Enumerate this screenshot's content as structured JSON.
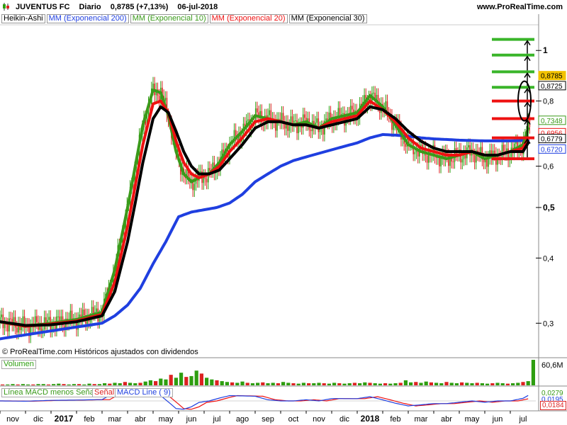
{
  "header": {
    "symbol": "JUVENTUS FC",
    "period": "Diario",
    "price": "0,8785 (+7,13%)",
    "date": "06-jul-2018",
    "brand": "www.ProRealTime.com"
  },
  "legend": {
    "heikin": "Heikin-Ashi",
    "ema200": "MM (Exponencial 200)",
    "ema10": "MM (Exponencial 10)",
    "ema20": "MM (Exponencial 20)",
    "ema30": "MM (Exponencial 30)"
  },
  "copyright": "© ProRealTime.com  Históricos ajustados con dividendos",
  "volume_panel": {
    "label": "Volumen",
    "value_label": "60,6M"
  },
  "macd_panel": {
    "label_hist": "Línea MACD menos Señal",
    "label_signal": "Señal",
    "label_line": "MACD Line ( 9)",
    "value_labels": [
      "0,0279",
      "0,0195",
      "0,0184"
    ]
  },
  "colors": {
    "ema200": "#1f3fe0",
    "ema10": "#3a9a1a",
    "ema20": "#ee1111",
    "ema30": "#000000",
    "up_candle": "#2e9e10",
    "down_candle": "#dd2222",
    "last_price": "#f2c200",
    "level_green": "#3ab52a",
    "level_red": "#ee1111"
  },
  "chart_data": {
    "type": "line",
    "scale": "log",
    "ylim": [
      0.27,
      1.12
    ],
    "x_ticks": [
      "nov",
      "dic",
      "2017",
      "feb",
      "mar",
      "abr",
      "may",
      "jun",
      "jul",
      "ago",
      "sep",
      "oct",
      "nov",
      "dic",
      "2018",
      "feb",
      "mar",
      "abr",
      "may",
      "jun",
      "jul"
    ],
    "y_ticks": [
      "1",
      "0,8",
      "0,6",
      "0,5",
      "0,4",
      "0,3"
    ],
    "y_tick_values": [
      1.0,
      0.8,
      0.6,
      0.5,
      0.4,
      0.3
    ],
    "price_labels": [
      {
        "text": "0,8785",
        "value": 0.8785,
        "color": "#f2c200"
      },
      {
        "text": "0,8725",
        "value": 0.8725,
        "color": "#000000"
      },
      {
        "text": "0,7348",
        "value": 0.7348,
        "color": "#3a9a1a"
      },
      {
        "text": "0,6956",
        "value": 0.6956,
        "color": "#ee1111"
      },
      {
        "text": "0,6779",
        "value": 0.6779,
        "color": "#000000"
      },
      {
        "text": "0,6720",
        "value": 0.672,
        "color": "#1f3fe0"
      }
    ],
    "x_months": [
      0,
      1,
      2,
      3,
      4,
      5,
      6,
      7,
      8,
      9,
      10,
      11,
      12,
      13,
      14,
      15,
      16,
      17,
      18,
      19,
      20,
      21
    ],
    "series": [
      {
        "name": "MM (Exponencial 10)",
        "color": "#3a9a1a",
        "x": [
          0,
          1,
          2,
          3,
          4,
          4.5,
          5,
          5.3,
          5.6,
          6,
          6.3,
          6.6,
          6.9,
          7.2,
          7.5,
          7.8,
          8.2,
          8.6,
          9,
          9.5,
          10,
          10.5,
          11,
          11.5,
          12,
          12.5,
          13,
          13.5,
          14,
          14.5,
          15,
          15.5,
          16,
          16.5,
          17,
          17.5,
          18,
          18.5,
          19,
          19.5,
          20,
          20.5,
          20.8
        ],
        "values": [
          0.302,
          0.296,
          0.3,
          0.305,
          0.315,
          0.38,
          0.5,
          0.6,
          0.72,
          0.84,
          0.83,
          0.75,
          0.64,
          0.58,
          0.56,
          0.57,
          0.58,
          0.61,
          0.66,
          0.7,
          0.75,
          0.74,
          0.73,
          0.72,
          0.73,
          0.71,
          0.74,
          0.75,
          0.76,
          0.82,
          0.78,
          0.72,
          0.66,
          0.64,
          0.63,
          0.62,
          0.63,
          0.64,
          0.62,
          0.63,
          0.64,
          0.66,
          0.7348
        ]
      },
      {
        "name": "MM (Exponencial 20)",
        "color": "#ee1111",
        "x": [
          0,
          1,
          2,
          3,
          4,
          4.5,
          5,
          5.3,
          5.6,
          6,
          6.3,
          6.6,
          6.9,
          7.2,
          7.5,
          7.8,
          8.2,
          8.6,
          9,
          9.5,
          10,
          10.5,
          11,
          11.5,
          12,
          12.5,
          13,
          13.5,
          14,
          14.5,
          15,
          15.5,
          16,
          16.5,
          17,
          17.5,
          18,
          18.5,
          19,
          19.5,
          20,
          20.5,
          20.8
        ],
        "values": [
          0.302,
          0.296,
          0.299,
          0.303,
          0.312,
          0.36,
          0.46,
          0.55,
          0.66,
          0.79,
          0.8,
          0.76,
          0.67,
          0.61,
          0.58,
          0.57,
          0.58,
          0.6,
          0.64,
          0.68,
          0.73,
          0.74,
          0.73,
          0.72,
          0.72,
          0.71,
          0.73,
          0.74,
          0.75,
          0.8,
          0.77,
          0.73,
          0.68,
          0.65,
          0.64,
          0.63,
          0.63,
          0.64,
          0.63,
          0.63,
          0.64,
          0.65,
          0.6956
        ]
      },
      {
        "name": "MM (Exponencial 30)",
        "color": "#000000",
        "x": [
          0,
          1,
          2,
          3,
          4,
          4.5,
          5,
          5.3,
          5.6,
          6,
          6.3,
          6.6,
          6.9,
          7.2,
          7.5,
          7.8,
          8.2,
          8.6,
          9,
          9.5,
          10,
          10.5,
          11,
          11.5,
          12,
          12.5,
          13,
          13.5,
          14,
          14.5,
          15,
          15.5,
          16,
          16.5,
          17,
          17.5,
          18,
          18.5,
          19,
          19.5,
          20,
          20.5,
          20.8
        ],
        "values": [
          0.302,
          0.297,
          0.298,
          0.302,
          0.31,
          0.345,
          0.43,
          0.51,
          0.61,
          0.74,
          0.78,
          0.76,
          0.7,
          0.64,
          0.6,
          0.58,
          0.58,
          0.59,
          0.62,
          0.66,
          0.71,
          0.73,
          0.73,
          0.72,
          0.72,
          0.71,
          0.72,
          0.73,
          0.74,
          0.78,
          0.77,
          0.74,
          0.7,
          0.67,
          0.65,
          0.64,
          0.64,
          0.64,
          0.63,
          0.63,
          0.64,
          0.64,
          0.6779
        ]
      },
      {
        "name": "MM (Exponencial 200)",
        "color": "#1f3fe0",
        "x": [
          0,
          1,
          2,
          3,
          4,
          4.5,
          5,
          5.5,
          6,
          6.5,
          7,
          7.5,
          8,
          8.5,
          9,
          9.5,
          10,
          10.5,
          11,
          11.5,
          12,
          12.5,
          13,
          13.5,
          14,
          14.5,
          15,
          15.5,
          16,
          16.5,
          17,
          17.5,
          18,
          18.5,
          19,
          19.5,
          20,
          20.5,
          20.8
        ],
        "values": [
          0.28,
          0.285,
          0.29,
          0.295,
          0.3,
          0.31,
          0.325,
          0.35,
          0.39,
          0.43,
          0.48,
          0.49,
          0.495,
          0.5,
          0.51,
          0.53,
          0.56,
          0.58,
          0.6,
          0.615,
          0.625,
          0.635,
          0.645,
          0.655,
          0.665,
          0.68,
          0.69,
          0.688,
          0.685,
          0.68,
          0.677,
          0.675,
          0.673,
          0.672,
          0.671,
          0.671,
          0.671,
          0.672,
          0.672
        ]
      }
    ],
    "levels_green": [
      1.05,
      0.98,
      0.91,
      0.85
    ],
    "levels_red": [
      0.8,
      0.74,
      0.68,
      0.62
    ],
    "volume_values": [
      2,
      2,
      3,
      2,
      3,
      2,
      2,
      3,
      3,
      2,
      3,
      4,
      3,
      2,
      3,
      3,
      2,
      4,
      3,
      3,
      5,
      4,
      6,
      5,
      8,
      6,
      5,
      6,
      9,
      12,
      10,
      16,
      14,
      25,
      18,
      30,
      20,
      22,
      35,
      28,
      18,
      14,
      12,
      10,
      8,
      7,
      6,
      9,
      6,
      5,
      6,
      7,
      5,
      6,
      5,
      8,
      6,
      5,
      4,
      6,
      5,
      5,
      6,
      5,
      4,
      6,
      5,
      4,
      5,
      6,
      5,
      7,
      6,
      5,
      4,
      5,
      4,
      5,
      6,
      12,
      7,
      8,
      6,
      9,
      7,
      6,
      5,
      8,
      6,
      5,
      7,
      6,
      5,
      6,
      5,
      4,
      5,
      6,
      5,
      4,
      5,
      6,
      8,
      10,
      60.6
    ]
  }
}
